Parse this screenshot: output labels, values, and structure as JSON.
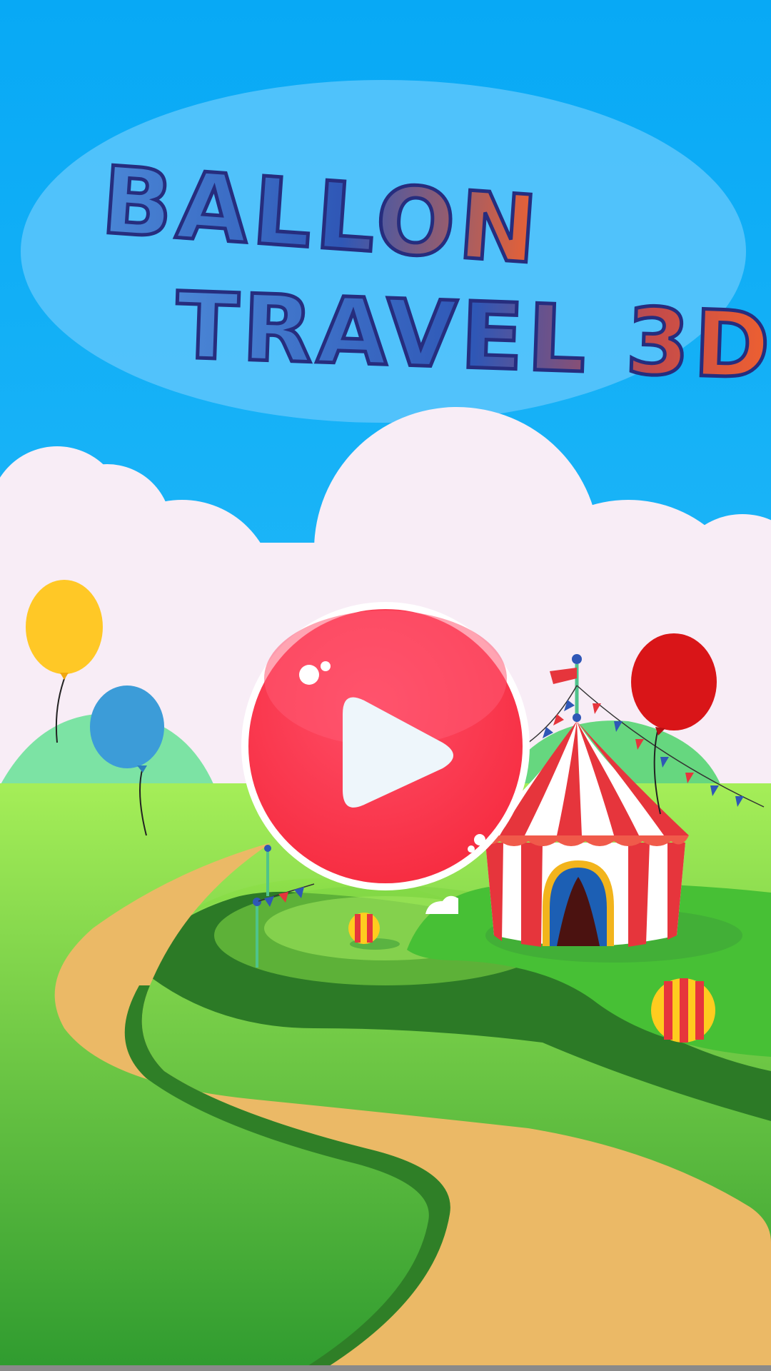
{
  "title": {
    "line1": "BALLON",
    "line2": "TRAVEL 3D"
  },
  "colors": {
    "sky_top": "#08a9f5",
    "sky_bottom": "#35c4fb",
    "title_blue": "#2f57b6",
    "title_orange": "#f0612f",
    "title_outline": "#262d7e",
    "cloud": "#f8edf6",
    "grass_light": "#a5ee58",
    "grass_dark": "#2d9b2f",
    "path": "#ebb966",
    "play_red": "#f9344c",
    "tent_red": "#e6353c",
    "balloon_yellow": "#ffc826",
    "balloon_blue": "#3c9cd8",
    "balloon_red": "#d91518"
  },
  "icons": {
    "play": "play-icon",
    "tent": "circus-tent-icon",
    "balloons": "balloon-icon"
  }
}
